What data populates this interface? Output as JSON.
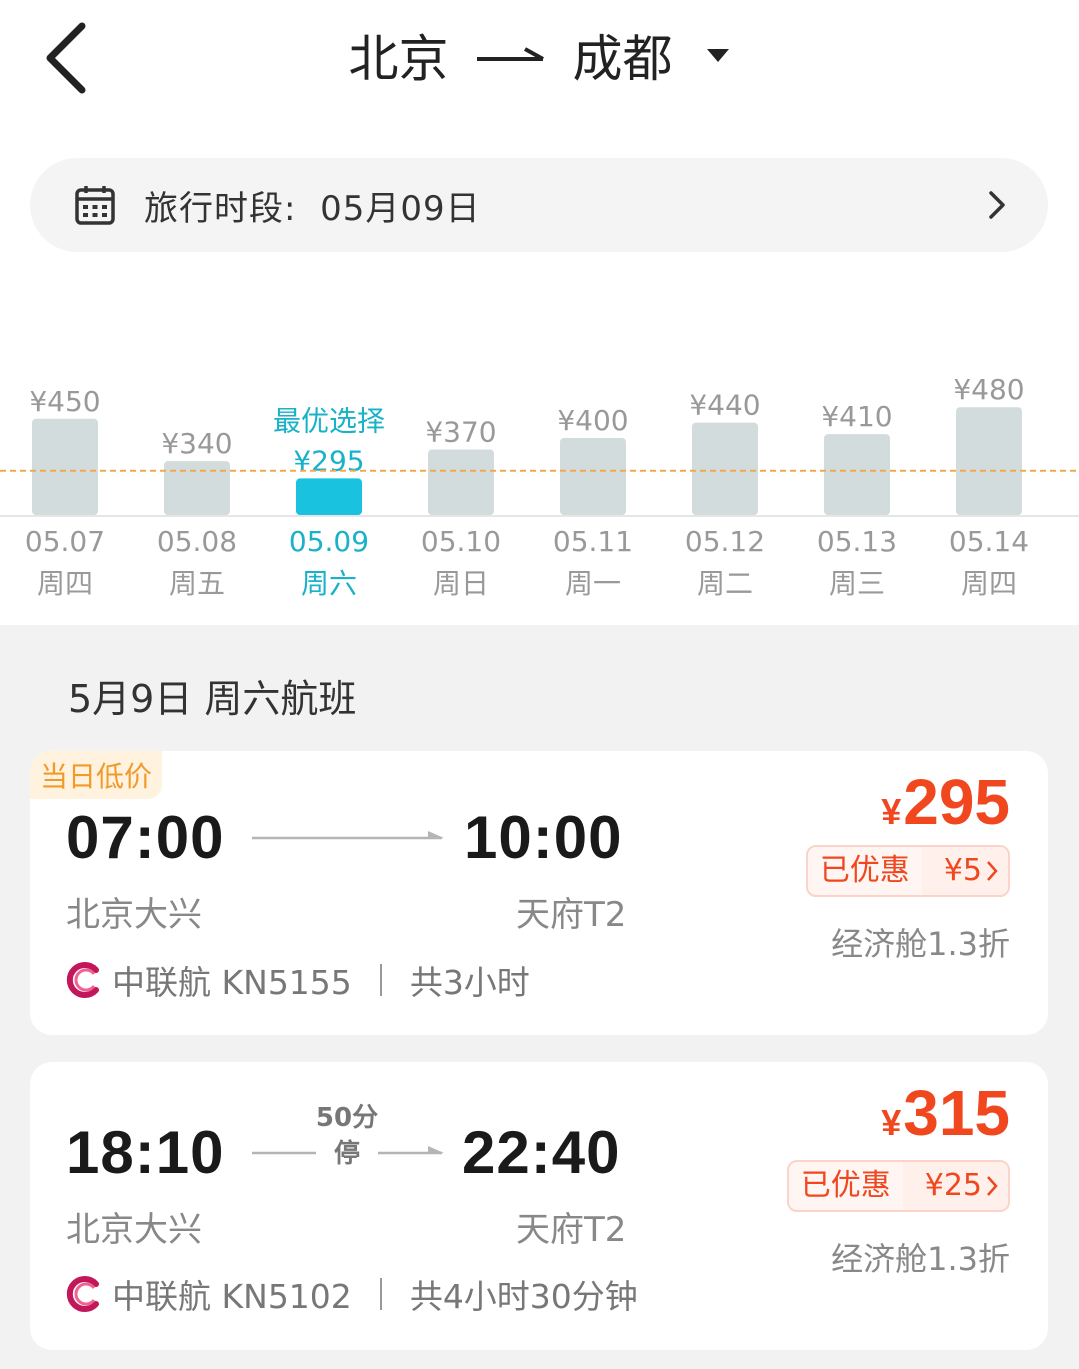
{
  "header": {
    "from_city": "北京",
    "to_city": "成都"
  },
  "date_bar": {
    "label": "旅行时段:",
    "date": "05月09日"
  },
  "chart_data": {
    "type": "bar",
    "categories": [
      "05.07",
      "05.08",
      "05.09",
      "05.10",
      "05.11",
      "05.12",
      "05.13",
      "05.14"
    ],
    "weekdays": [
      "周四",
      "周五",
      "周六",
      "周日",
      "周一",
      "周二",
      "周三",
      "周四"
    ],
    "values": [
      450,
      340,
      295,
      370,
      400,
      440,
      410,
      480
    ],
    "price_labels": [
      "¥450",
      "¥340",
      "¥295",
      "¥370",
      "¥400",
      "¥440",
      "¥410",
      "¥480"
    ],
    "selected_index": 2,
    "best_label": "最优选择",
    "reference_line_value": 315,
    "colors": {
      "bar": "#d3dcdc",
      "selected": "#19c3df",
      "reference_line": "#f2a94e",
      "selected_text": "#19b2c9",
      "text": "#999999"
    }
  },
  "section": {
    "title": "5月9日 周六航班"
  },
  "flights": [
    {
      "badge": "当日低价",
      "dep_time": "07:00",
      "arr_time": "10:00",
      "dep_airport": "北京大兴",
      "arr_airport": "天府T2",
      "airline": "中联航 KN5155",
      "duration": "共3小时",
      "price_currency": "¥",
      "price": "295",
      "discount_label": "已优惠",
      "discount_amount": "¥5",
      "cabin": "经济舱1.3折"
    },
    {
      "dep_time": "18:10",
      "arr_time": "22:40",
      "stop_top": "50分",
      "stop_bottom": "停",
      "dep_airport": "北京大兴",
      "arr_airport": "天府T2",
      "airline": "中联航 KN5102",
      "duration": "共4小时30分钟",
      "price_currency": "¥",
      "price": "315",
      "discount_label": "已优惠",
      "discount_amount": "¥25",
      "cabin": "经济舱1.3折"
    }
  ],
  "icons": {
    "back": "chevron-left-icon",
    "dropdown": "caret-down-icon",
    "calendar": "calendar-icon",
    "forward": "chevron-right-icon",
    "airline_logo": "china-united-airlines-logo-icon"
  }
}
